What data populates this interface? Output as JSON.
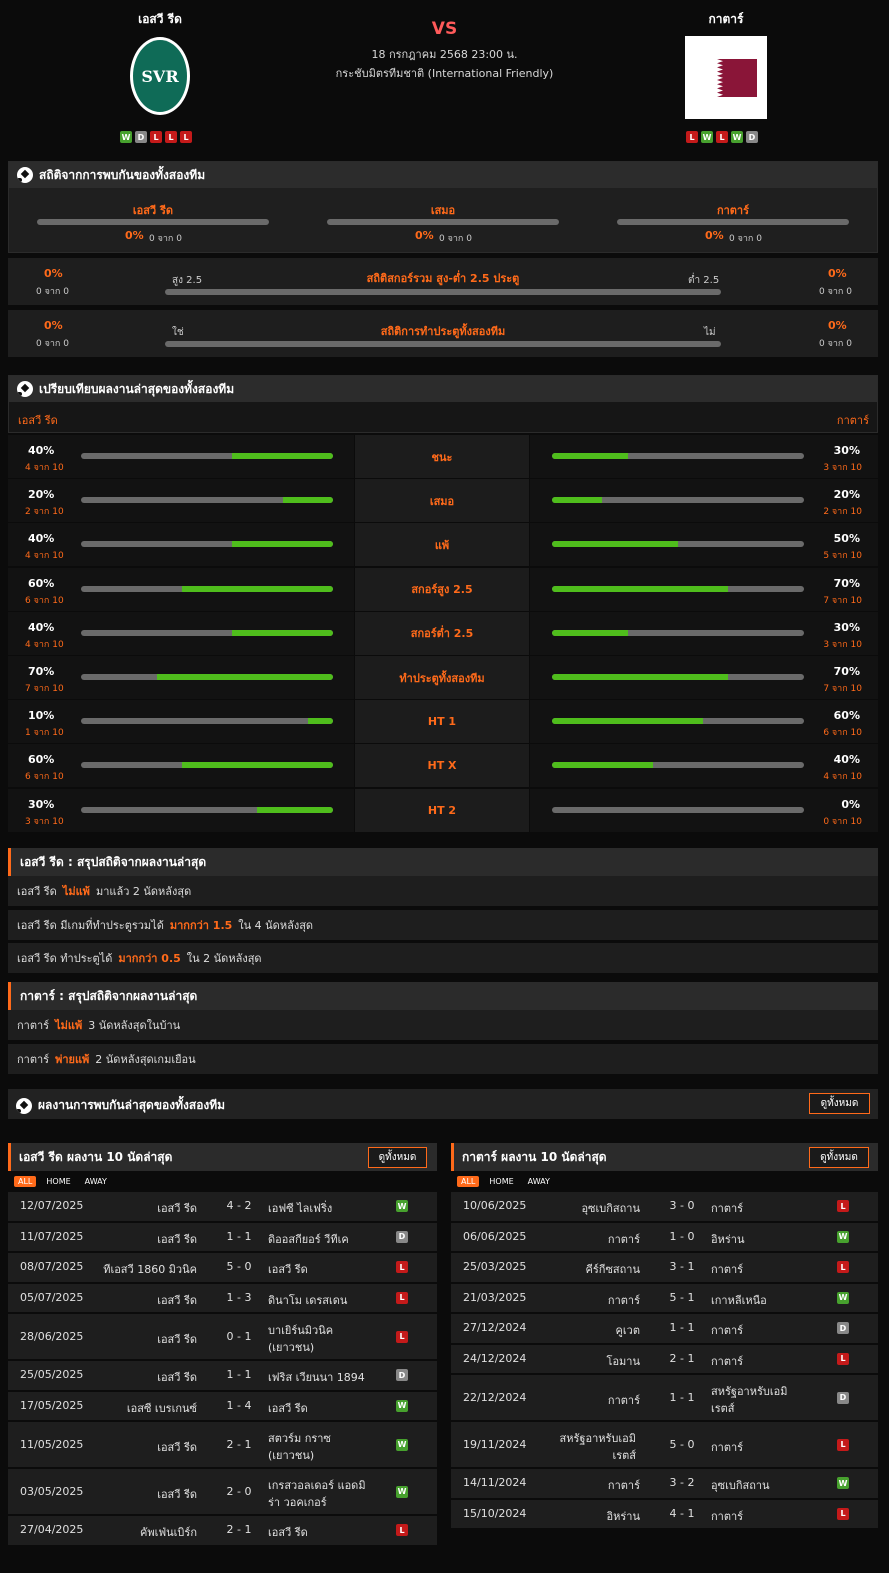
{
  "header": {
    "home_team": "เอสวี รีด",
    "away_team": "กาตาร์",
    "vs": "VS",
    "date": "18 กรกฎาคม 2568 23:00 น.",
    "competition": "กระชับมิตรทีมชาติ (International Friendly)",
    "home_logo_text": "SVR",
    "home_form": [
      "W",
      "D",
      "L",
      "L",
      "L"
    ],
    "away_form": [
      "L",
      "W",
      "L",
      "W",
      "D"
    ]
  },
  "h2h": {
    "title": "สถิติจากการพบกันของทั้งสองทีม",
    "cols": [
      {
        "label": "เอสวี รีด",
        "pct": "0%",
        "sub": "0 จาก 0"
      },
      {
        "label": "เสมอ",
        "pct": "0%",
        "sub": "0 จาก 0"
      },
      {
        "label": "กาตาร์",
        "pct": "0%",
        "sub": "0 จาก 0"
      }
    ],
    "goals": {
      "title": "สถิติสกอร์รวม สูง-ต่ำ 2.5 ประตู",
      "left_label": "สูง 2.5",
      "right_label": "ต่ำ 2.5",
      "left_pct": "0%",
      "left_sub": "0 จาก 0",
      "right_pct": "0%",
      "right_sub": "0 จาก 0"
    },
    "btts": {
      "title": "สถิติการทำประตูทั้งสองทีม",
      "left_label": "ใช่",
      "right_label": "ไม่",
      "left_pct": "0%",
      "left_sub": "0 จาก 0",
      "right_pct": "0%",
      "right_sub": "0 จาก 0"
    }
  },
  "compare": {
    "title": "เปรียบเทียบผลงานล่าสุดของทั้งสองทีม",
    "home_label": "เอสวี รีด",
    "away_label": "กาตาร์",
    "rows": [
      {
        "label": "ชนะ",
        "home_pct": "40%",
        "home_sub": "4 จาก 10",
        "home_val": 0.4,
        "away_pct": "30%",
        "away_sub": "3 จาก 10",
        "away_val": 0.3
      },
      {
        "label": "เสมอ",
        "home_pct": "20%",
        "home_sub": "2 จาก 10",
        "home_val": 0.2,
        "away_pct": "20%",
        "away_sub": "2 จาก 10",
        "away_val": 0.2
      },
      {
        "label": "แพ้",
        "home_pct": "40%",
        "home_sub": "4 จาก 10",
        "home_val": 0.4,
        "away_pct": "50%",
        "away_sub": "5 จาก 10",
        "away_val": 0.5
      },
      {
        "label": "สกอร์สูง 2.5",
        "home_pct": "60%",
        "home_sub": "6 จาก 10",
        "home_val": 0.6,
        "away_pct": "70%",
        "away_sub": "7 จาก 10",
        "away_val": 0.7
      },
      {
        "label": "สกอร์ต่ำ 2.5",
        "home_pct": "40%",
        "home_sub": "4 จาก 10",
        "home_val": 0.4,
        "away_pct": "30%",
        "away_sub": "3 จาก 10",
        "away_val": 0.3
      },
      {
        "label": "ทำประตูทั้งสองทีม",
        "home_pct": "70%",
        "home_sub": "7 จาก 10",
        "home_val": 0.7,
        "away_pct": "70%",
        "away_sub": "7 จาก 10",
        "away_val": 0.7
      },
      {
        "label": "HT 1",
        "home_pct": "10%",
        "home_sub": "1 จาก 10",
        "home_val": 0.1,
        "away_pct": "60%",
        "away_sub": "6 จาก 10",
        "away_val": 0.6
      },
      {
        "label": "HT X",
        "home_pct": "60%",
        "home_sub": "6 จาก 10",
        "home_val": 0.6,
        "away_pct": "40%",
        "away_sub": "4 จาก 10",
        "away_val": 0.4
      },
      {
        "label": "HT 2",
        "home_pct": "30%",
        "home_sub": "3 จาก 10",
        "home_val": 0.3,
        "away_pct": "0%",
        "away_sub": "0 จาก 10",
        "away_val": 0.0
      }
    ]
  },
  "home_summary": {
    "title": "เอสวี รีด : สรุปสถิติจากผลงานล่าสุด",
    "lines": [
      {
        "a": "เอสวี รีด",
        "b": "ไม่แพ้",
        "c": "มาแล้ว 2 นัดหลังสุด"
      },
      {
        "a": "เอสวี รีด มีเกมที่ทำประตูรวมได้",
        "b": "มากกว่า 1.5",
        "c": "ใน 4 นัดหลังสุด"
      },
      {
        "a": "เอสวี รีด ทำประตูได้",
        "b": "มากกว่า 0.5",
        "c": "ใน 2 นัดหลังสุด"
      }
    ]
  },
  "away_summary": {
    "title": "กาตาร์ : สรุปสถิติจากผลงานล่าสุด",
    "lines": [
      {
        "a": "กาตาร์",
        "b": "ไม่แพ้",
        "c": "3 นัดหลังสุดในบ้าน"
      },
      {
        "a": "กาตาร์",
        "b": "พ่ายแพ้",
        "c": "2 นัดหลังสุดเกมเยือน"
      }
    ]
  },
  "h2h_recent": {
    "title": "ผลงานการพบกันล่าสุดของทั้งสองทีม",
    "view_all": "ดูทั้งหมด"
  },
  "home_matches": {
    "title": "เอสวี รีด ผลงาน 10 นัดล่าสุด",
    "view_all": "ดูทั้งหมด",
    "tabs": [
      "ALL",
      "HOME",
      "AWAY"
    ],
    "rows": [
      {
        "date": "12/07/2025",
        "home": "เอสวี รีด",
        "score": "4 - 2",
        "away": "เอฟซี ไลเฟริ่ง",
        "res": "W"
      },
      {
        "date": "11/07/2025",
        "home": "เอสวี รีด",
        "score": "1 - 1",
        "away": "ดิออสกียอร์ วีทีเค",
        "res": "D"
      },
      {
        "date": "08/07/2025",
        "home": "ทีเอสวี 1860 มิวนิค",
        "score": "5 - 0",
        "away": "เอสวี รีด",
        "res": "L"
      },
      {
        "date": "05/07/2025",
        "home": "เอสวี รีด",
        "score": "1 - 3",
        "away": "ดินาโม เดรสเดน",
        "res": "L"
      },
      {
        "date": "28/06/2025",
        "home": "เอสวี รีด",
        "score": "0 - 1",
        "away": "บาเยิร์นมิวนิค",
        "away2": "(เยาวชน)",
        "res": "L"
      },
      {
        "date": "25/05/2025",
        "home": "เอสวี รีด",
        "score": "1 - 1",
        "away": "เฟริส เวียนนา 1894",
        "res": "D"
      },
      {
        "date": "17/05/2025",
        "home": "เอสซี เบรเกนซ์",
        "score": "1 - 4",
        "away": "เอสวี รีด",
        "res": "W"
      },
      {
        "date": "11/05/2025",
        "home": "เอสวี รีด",
        "score": "2 - 1",
        "away": "สตวร์ม กราซ",
        "away2": "(เยาวชน)",
        "res": "W"
      },
      {
        "date": "03/05/2025",
        "home": "เอสวี รีด",
        "score": "2 - 0",
        "away": "เกรสวอลเดอร์ แอดมิ",
        "away2": "ร่า วอคเกอร์",
        "res": "W"
      },
      {
        "date": "27/04/2025",
        "home": "คัพเฟ่นเบิร์ก",
        "score": "2 - 1",
        "away": "เอสวี รีด",
        "res": "L"
      }
    ]
  },
  "away_matches": {
    "title": "กาตาร์ ผลงาน 10 นัดล่าสุด",
    "view_all": "ดูทั้งหมด",
    "tabs": [
      "ALL",
      "HOME",
      "AWAY"
    ],
    "rows": [
      {
        "date": "10/06/2025",
        "home": "อุซเบกิสถาน",
        "score": "3 - 0",
        "away": "กาตาร์",
        "res": "L"
      },
      {
        "date": "06/06/2025",
        "home": "กาตาร์",
        "score": "1 - 0",
        "away": "อิหร่าน",
        "res": "W"
      },
      {
        "date": "25/03/2025",
        "home": "คีร์กีซสถาน",
        "score": "3 - 1",
        "away": "กาตาร์",
        "res": "L"
      },
      {
        "date": "21/03/2025",
        "home": "กาตาร์",
        "score": "5 - 1",
        "away": "เกาหลีเหนือ",
        "res": "W"
      },
      {
        "date": "27/12/2024",
        "home": "คูเวต",
        "score": "1 - 1",
        "away": "กาตาร์",
        "res": "D"
      },
      {
        "date": "24/12/2024",
        "home": "โอมาน",
        "score": "2 - 1",
        "away": "กาตาร์",
        "res": "L"
      },
      {
        "date": "22/12/2024",
        "home": "กาตาร์",
        "score": "1 - 1",
        "away": "สหรัฐอาหรับเอมิ",
        "away2": "เรตส์",
        "res": "D"
      },
      {
        "date": "19/11/2024",
        "home": "สหรัฐอาหรับเอมิ",
        "home2": "เรตส์",
        "score": "5 - 0",
        "away": "กาตาร์",
        "res": "L"
      },
      {
        "date": "14/11/2024",
        "home": "กาตาร์",
        "score": "3 - 2",
        "away": "อุซเบกิสถาน",
        "res": "W"
      },
      {
        "date": "15/10/2024",
        "home": "อิหร่าน",
        "score": "4 - 1",
        "away": "กาตาร์",
        "res": "L"
      }
    ]
  }
}
